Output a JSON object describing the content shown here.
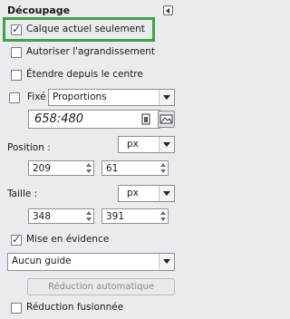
{
  "panel": {
    "title": "Découpage"
  },
  "options": {
    "current_layer_only": {
      "label": "Calque actuel seulement",
      "checked": true
    },
    "allow_growing": {
      "label": "Autoriser l'agrandissement",
      "checked": false
    },
    "expand_from_center": {
      "label": "Étendre depuis le centre",
      "checked": false
    },
    "fixed": {
      "label": "Fixé :",
      "checked": false,
      "mode": "Proportions"
    },
    "ratio": "658:480",
    "highlight": {
      "label": "Mise en évidence",
      "checked": true
    },
    "merged_shrink": {
      "label": "Réduction fusionnée",
      "checked": false
    }
  },
  "position": {
    "label": "Position :",
    "unit": "px",
    "x": "209",
    "y": "61"
  },
  "size": {
    "label": "Taille :",
    "unit": "px",
    "width": "348",
    "height": "391"
  },
  "guides": {
    "selected": "Aucun guide"
  },
  "auto_shrink": {
    "label": "Réduction automatique"
  },
  "colors": {
    "highlight_border": "#3ea446",
    "background": "#e9ebee"
  }
}
